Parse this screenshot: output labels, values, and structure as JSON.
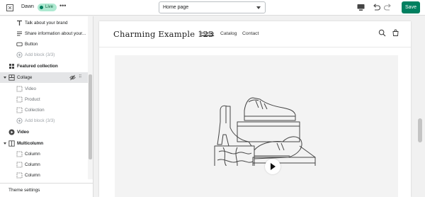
{
  "topbar": {
    "store_name": "Dawn",
    "status_badge": "Live",
    "more_label": "•••",
    "page_selector_value": "Home page",
    "save_label": "Save"
  },
  "sidebar": {
    "items": [
      {
        "label": "Talk about your brand",
        "icon": "text-heading-icon"
      },
      {
        "label": "Share information about your...",
        "icon": "text-paragraph-icon"
      },
      {
        "label": "Button",
        "icon": "button-icon"
      },
      {
        "label": "Add block (3/3)",
        "icon": "add-circle-icon"
      },
      {
        "label": "Featured collection",
        "icon": "grid-icon"
      },
      {
        "label": "Collage",
        "icon": "collage-icon"
      },
      {
        "label": "Video",
        "icon": "dashed-square-icon"
      },
      {
        "label": "Product",
        "icon": "dashed-square-icon"
      },
      {
        "label": "Collection",
        "icon": "dashed-square-icon"
      },
      {
        "label": "Add block (3/3)",
        "icon": "add-circle-icon"
      },
      {
        "label": "Video",
        "icon": "play-circle-icon"
      },
      {
        "label": "Multicolumn",
        "icon": "columns-icon"
      },
      {
        "label": "Column",
        "icon": "dashed-square-icon"
      },
      {
        "label": "Column",
        "icon": "dashed-square-icon"
      },
      {
        "label": "Column",
        "icon": "dashed-square-icon"
      }
    ],
    "footer_label": "Theme settings"
  },
  "preview": {
    "site_title": "Charming Example 123",
    "nav": [
      "Home",
      "Catalog",
      "Contact"
    ],
    "media_icon": "shoes-illustration"
  },
  "colors": {
    "accent": "#008060",
    "live_badge": "#aee9d1"
  }
}
